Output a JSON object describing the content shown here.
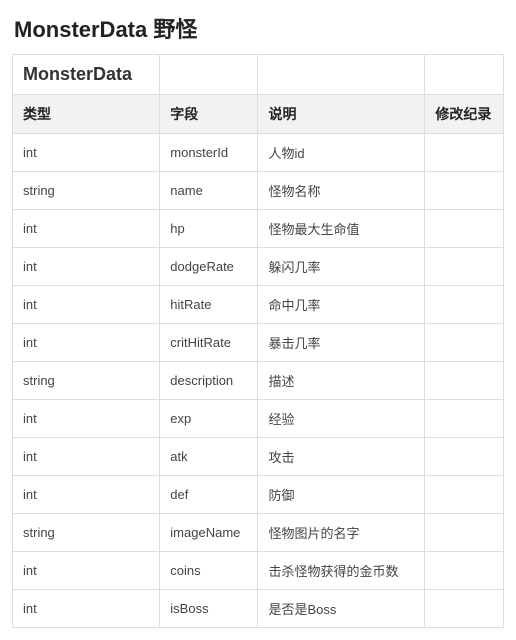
{
  "title": "MonsterData 野怪",
  "tableTitle": "MonsterData",
  "headers": {
    "type": "类型",
    "field": "字段",
    "desc": "说明",
    "log": "修改纪录"
  },
  "rows": [
    {
      "type": "int",
      "field": "monsterId",
      "desc": "人物id",
      "log": ""
    },
    {
      "type": "string",
      "field": "name",
      "desc": "怪物名称",
      "log": ""
    },
    {
      "type": "int",
      "field": "hp",
      "desc": "怪物最大生命值",
      "log": ""
    },
    {
      "type": "int",
      "field": "dodgeRate",
      "desc": "躲闪几率",
      "log": ""
    },
    {
      "type": "int",
      "field": "hitRate",
      "desc": "命中几率",
      "log": ""
    },
    {
      "type": "int",
      "field": "critHitRate",
      "desc": "暴击几率",
      "log": ""
    },
    {
      "type": "string",
      "field": "description",
      "desc": "描述",
      "log": ""
    },
    {
      "type": "int",
      "field": "exp",
      "desc": "经验",
      "log": ""
    },
    {
      "type": "int",
      "field": "atk",
      "desc": "攻击",
      "log": ""
    },
    {
      "type": "int",
      "field": "def",
      "desc": "防御",
      "log": ""
    },
    {
      "type": "string",
      "field": "imageName",
      "desc": "怪物图片的名字",
      "log": ""
    },
    {
      "type": "int",
      "field": "coins",
      "desc": "击杀怪物获得的金币数",
      "log": ""
    },
    {
      "type": "int",
      "field": "isBoss",
      "desc": "是否是Boss",
      "log": ""
    }
  ]
}
